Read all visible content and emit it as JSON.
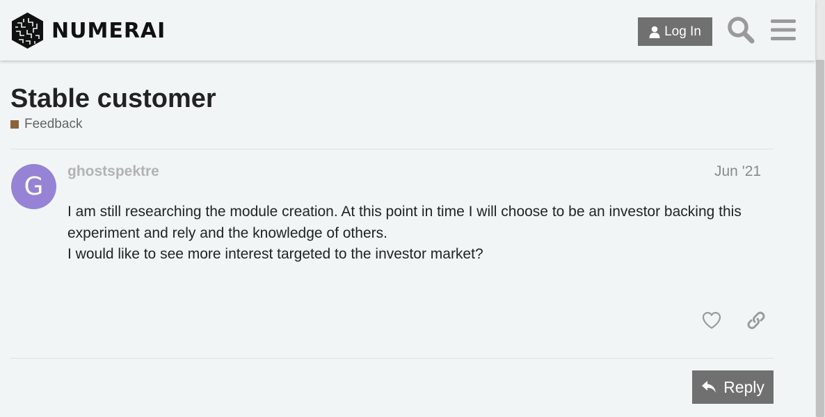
{
  "header": {
    "logo_text": "NUMERAI",
    "login_label": "Log In",
    "icons": [
      "user-icon",
      "search-icon",
      "hamburger-menu-icon"
    ]
  },
  "topic": {
    "title": "Stable customer",
    "category": {
      "label": "Feedback",
      "color": "#8c6238"
    }
  },
  "post": {
    "avatar_letter": "G",
    "avatar_color": "#9683d5",
    "username": "ghostspektre",
    "date": "Jun '21",
    "paragraphs": [
      "I am still researching the module creation. At this point in time I will choose to be an investor backing this experiment and rely and the knowledge of others.",
      "I would like to see more interest targeted to the investor market?"
    ],
    "actions": [
      "heart-icon",
      "link-icon"
    ]
  },
  "footer": {
    "reply_label": "Reply"
  },
  "colors": {
    "background": "#f1f5f6",
    "button": "#707070",
    "text": "#222222",
    "muted": "#646464"
  }
}
